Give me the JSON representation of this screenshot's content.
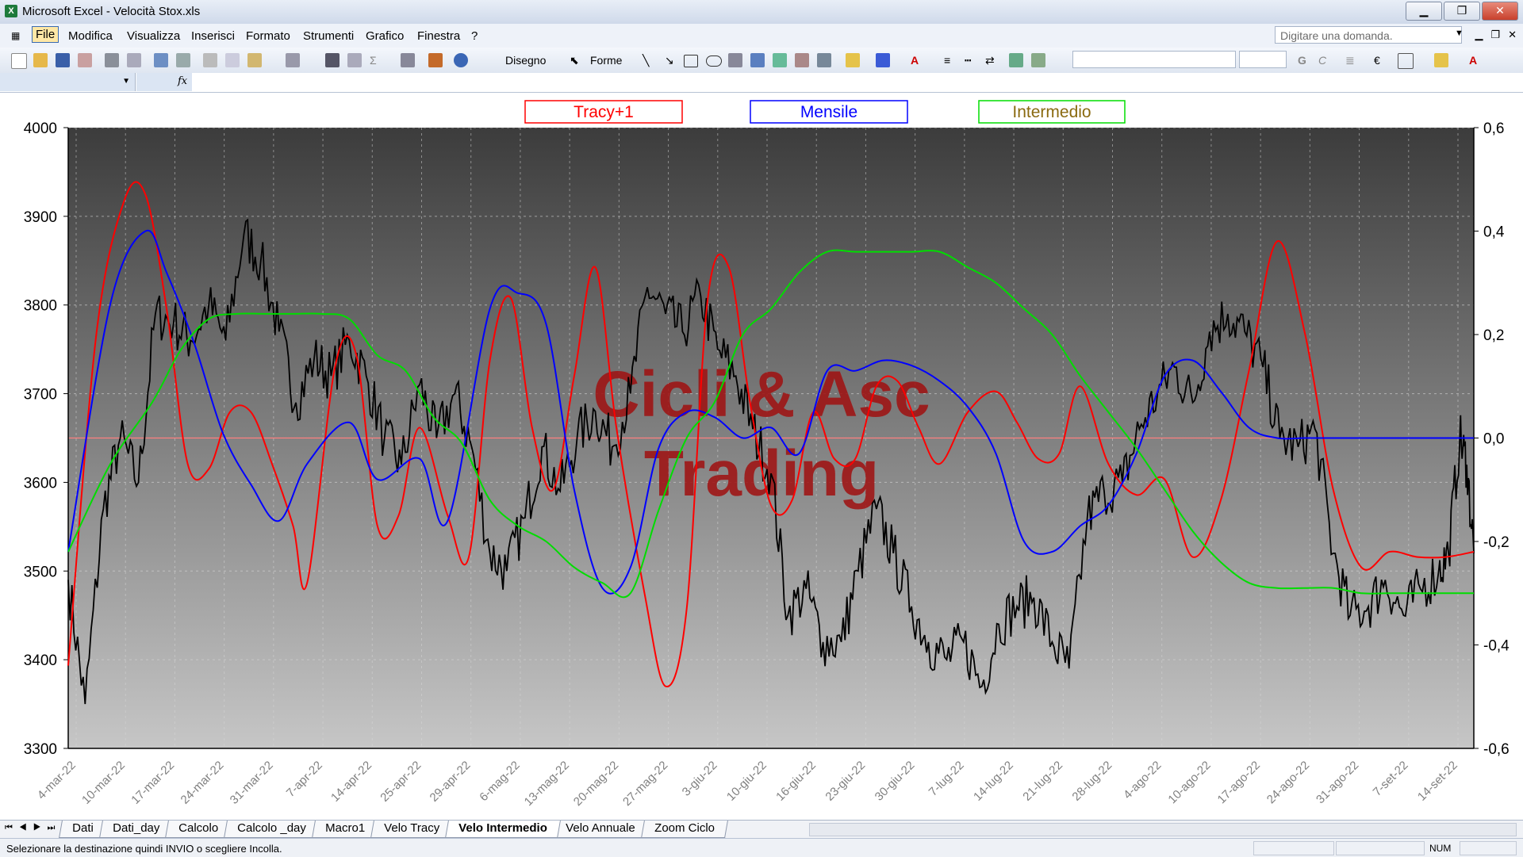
{
  "window": {
    "app_title": "Microsoft Excel - Velocità Stox.xls",
    "minimize": "▁",
    "restore": "❐",
    "close": "✕"
  },
  "menu": {
    "items": [
      "File",
      "Modifica",
      "Visualizza",
      "Inserisci",
      "Formato",
      "Strumenti",
      "Grafico",
      "Finestra",
      "?"
    ],
    "help_placeholder": "Digitare una domanda."
  },
  "toolbar": {
    "draw_label": "Disegno",
    "shapes_label": "Forme"
  },
  "sheet_tabs": [
    "Dati",
    "Dati_day",
    "Calcolo",
    "Calcolo _day",
    "Macro1",
    "Velo Tracy",
    "Velo Intermedio",
    "Velo Annuale",
    "Zoom Ciclo"
  ],
  "active_tab": "Velo Intermedio",
  "status": {
    "text": "Selezionare la destinazione quindi INVIO o scegliere Incolla.",
    "num": "NUM"
  },
  "chart_data": {
    "type": "line",
    "watermark": [
      "Cicli & Asc",
      "Trading"
    ],
    "legend": [
      {
        "name": "Tracy+1",
        "color": "#ff0000"
      },
      {
        "name": "Mensile",
        "color": "#0000ff"
      },
      {
        "name": "Intermedio",
        "color": "#00dd00"
      }
    ],
    "y_left": {
      "min": 3300,
      "max": 4000,
      "ticks": [
        4000,
        3900,
        3800,
        3700,
        3600,
        3500,
        3400,
        3300
      ]
    },
    "y_right": {
      "min": -0.6,
      "max": 0.6,
      "ticks": [
        "0,6",
        "0,4",
        "0,2",
        "0,0",
        "-0,2",
        "-0,4",
        "-0,6"
      ]
    },
    "x_labels": [
      "4-mar-22",
      "10-mar-22",
      "17-mar-22",
      "24-mar-22",
      "31-mar-22",
      "7-apr-22",
      "14-apr-22",
      "25-apr-22",
      "29-apr-22",
      "6-mag-22",
      "13-mag-22",
      "20-mag-22",
      "27-mag-22",
      "3-giu-22",
      "10-giu-22",
      "16-giu-22",
      "23-giu-22",
      "30-giu-22",
      "7-lug-22",
      "14-lug-22",
      "21-lug-22",
      "28-lug-22",
      "4-ago-22",
      "10-ago-22",
      "17-ago-22",
      "24-ago-22",
      "31-ago-22",
      "7-set-22",
      "14-set-22"
    ],
    "price_axis": "left",
    "indicator_axis": "right",
    "price": [
      3490,
      3350,
      3570,
      3650,
      3600,
      3790,
      3780,
      3760,
      3800,
      3760,
      3880,
      3850,
      3770,
      3690,
      3740,
      3720,
      3760,
      3720,
      3650,
      3620,
      3710,
      3650,
      3700,
      3640,
      3520,
      3500,
      3560,
      3640,
      3590,
      3650,
      3680,
      3640,
      3700,
      3820,
      3790,
      3770,
      3810,
      3750,
      3720,
      3660,
      3610,
      3450,
      3480,
      3420,
      3420,
      3500,
      3570,
      3520,
      3460,
      3420,
      3400,
      3420,
      3370,
      3440,
      3460,
      3470,
      3420,
      3390,
      3560,
      3590,
      3600,
      3660,
      3700,
      3730,
      3690,
      3770,
      3790,
      3770,
      3730,
      3650,
      3640,
      3660,
      3520,
      3450,
      3460,
      3490,
      3450,
      3480,
      3500,
      3520,
      3650,
      3620,
      3520
    ],
    "price_x": [
      0,
      0.012,
      0.025,
      0.037,
      0.05,
      0.062,
      0.075,
      0.087,
      0.1,
      0.112,
      0.125,
      0.137,
      0.15,
      0.162,
      0.175,
      0.187,
      0.2,
      0.212,
      0.225,
      0.237,
      0.25,
      0.262,
      0.275,
      0.287,
      0.3,
      0.312,
      0.325,
      0.337,
      0.35,
      0.362,
      0.375,
      0.387,
      0.4,
      0.412,
      0.425,
      0.437,
      0.45,
      0.462,
      0.475,
      0.487,
      0.5,
      0.512,
      0.525,
      0.537,
      0.55,
      0.562,
      0.575,
      0.587,
      0.6,
      0.612,
      0.625,
      0.637,
      0.65,
      0.662,
      0.675,
      0.687,
      0.7,
      0.712,
      0.725,
      0.737,
      0.75,
      0.762,
      0.775,
      0.787,
      0.8,
      0.812,
      0.825,
      0.837,
      0.85,
      0.862,
      0.875,
      0.887,
      0.9,
      0.912,
      0.925,
      0.937,
      0.95,
      0.962,
      0.975,
      0.982,
      0.99,
      0.995,
      1
    ],
    "series": [
      {
        "name": "Tracy+1",
        "x": [
          0,
          0.02,
          0.04,
          0.055,
          0.07,
          0.085,
          0.1,
          0.115,
          0.13,
          0.145,
          0.16,
          0.17,
          0.19,
          0.205,
          0.22,
          0.235,
          0.25,
          0.27,
          0.285,
          0.3,
          0.315,
          0.33,
          0.345,
          0.36,
          0.375,
          0.39,
          0.41,
          0.425,
          0.44,
          0.455,
          0.47,
          0.485,
          0.5,
          0.515,
          0.53,
          0.545,
          0.56,
          0.575,
          0.59,
          0.605,
          0.62,
          0.64,
          0.66,
          0.675,
          0.69,
          0.705,
          0.72,
          0.74,
          0.76,
          0.78,
          0.8,
          0.82,
          0.84,
          0.86,
          0.88,
          0.9,
          0.92,
          0.94,
          0.96,
          0.98,
          1
        ],
        "values": [
          -0.44,
          0.2,
          0.46,
          0.47,
          0.25,
          -0.05,
          -0.06,
          0.05,
          0.05,
          -0.05,
          -0.17,
          -0.28,
          0.14,
          0.16,
          -0.17,
          -0.15,
          0.02,
          -0.15,
          -0.23,
          0.15,
          0.27,
          0.02,
          -0.1,
          0.12,
          0.33,
          0.02,
          -0.3,
          -0.48,
          -0.33,
          0.27,
          0.33,
          0.07,
          -0.13,
          -0.12,
          0.05,
          -0.04,
          -0.04,
          0.1,
          0.11,
          0.02,
          -0.05,
          0.05,
          0.09,
          0.03,
          -0.04,
          -0.03,
          0.1,
          -0.05,
          -0.11,
          -0.08,
          -0.23,
          -0.12,
          0.13,
          0.38,
          0.2,
          -0.1,
          -0.25,
          -0.22,
          -0.23,
          -0.23,
          -0.22
        ]
      },
      {
        "name": "Mensile",
        "x": [
          0,
          0.03,
          0.055,
          0.07,
          0.09,
          0.11,
          0.13,
          0.15,
          0.17,
          0.2,
          0.22,
          0.25,
          0.27,
          0.3,
          0.32,
          0.34,
          0.36,
          0.38,
          0.4,
          0.42,
          0.44,
          0.46,
          0.48,
          0.5,
          0.52,
          0.54,
          0.56,
          0.58,
          0.6,
          0.62,
          0.64,
          0.66,
          0.68,
          0.7,
          0.72,
          0.74,
          0.76,
          0.78,
          0.8,
          0.82,
          0.84,
          0.86,
          0.88,
          0.9,
          0.92,
          0.94,
          0.96,
          0.98,
          1
        ],
        "values": [
          -0.22,
          0.26,
          0.4,
          0.32,
          0.18,
          0.01,
          -0.09,
          -0.16,
          -0.05,
          0.03,
          -0.08,
          -0.04,
          -0.16,
          0.25,
          0.28,
          0.22,
          -0.1,
          -0.29,
          -0.25,
          -0.02,
          0.05,
          0.04,
          0.0,
          0.02,
          -0.03,
          0.13,
          0.13,
          0.15,
          0.14,
          0.11,
          0.06,
          -0.03,
          -0.2,
          -0.22,
          -0.17,
          -0.13,
          -0.03,
          0.12,
          0.15,
          0.09,
          0.02,
          0.0,
          0.0,
          0.0,
          0.0,
          0.0,
          0.0,
          0.0,
          0.0
        ]
      },
      {
        "name": "Intermedio",
        "x": [
          0,
          0.03,
          0.06,
          0.08,
          0.1,
          0.12,
          0.14,
          0.16,
          0.18,
          0.2,
          0.22,
          0.24,
          0.26,
          0.28,
          0.3,
          0.32,
          0.34,
          0.36,
          0.38,
          0.4,
          0.42,
          0.44,
          0.46,
          0.48,
          0.5,
          0.52,
          0.54,
          0.56,
          0.58,
          0.6,
          0.62,
          0.64,
          0.66,
          0.68,
          0.7,
          0.72,
          0.74,
          0.76,
          0.78,
          0.8,
          0.82,
          0.84,
          0.86,
          0.88,
          0.9,
          0.92,
          0.94,
          0.96,
          0.98,
          1
        ],
        "values": [
          -0.22,
          -0.05,
          0.07,
          0.17,
          0.23,
          0.24,
          0.24,
          0.24,
          0.24,
          0.23,
          0.16,
          0.13,
          0.04,
          -0.01,
          -0.12,
          -0.17,
          -0.2,
          -0.25,
          -0.28,
          -0.3,
          -0.14,
          0.0,
          0.07,
          0.2,
          0.25,
          0.32,
          0.36,
          0.36,
          0.36,
          0.36,
          0.36,
          0.33,
          0.3,
          0.25,
          0.2,
          0.12,
          0.05,
          -0.02,
          -0.1,
          -0.18,
          -0.24,
          -0.28,
          -0.29,
          -0.29,
          -0.29,
          -0.3,
          -0.3,
          -0.3,
          -0.3,
          -0.3
        ]
      }
    ]
  }
}
